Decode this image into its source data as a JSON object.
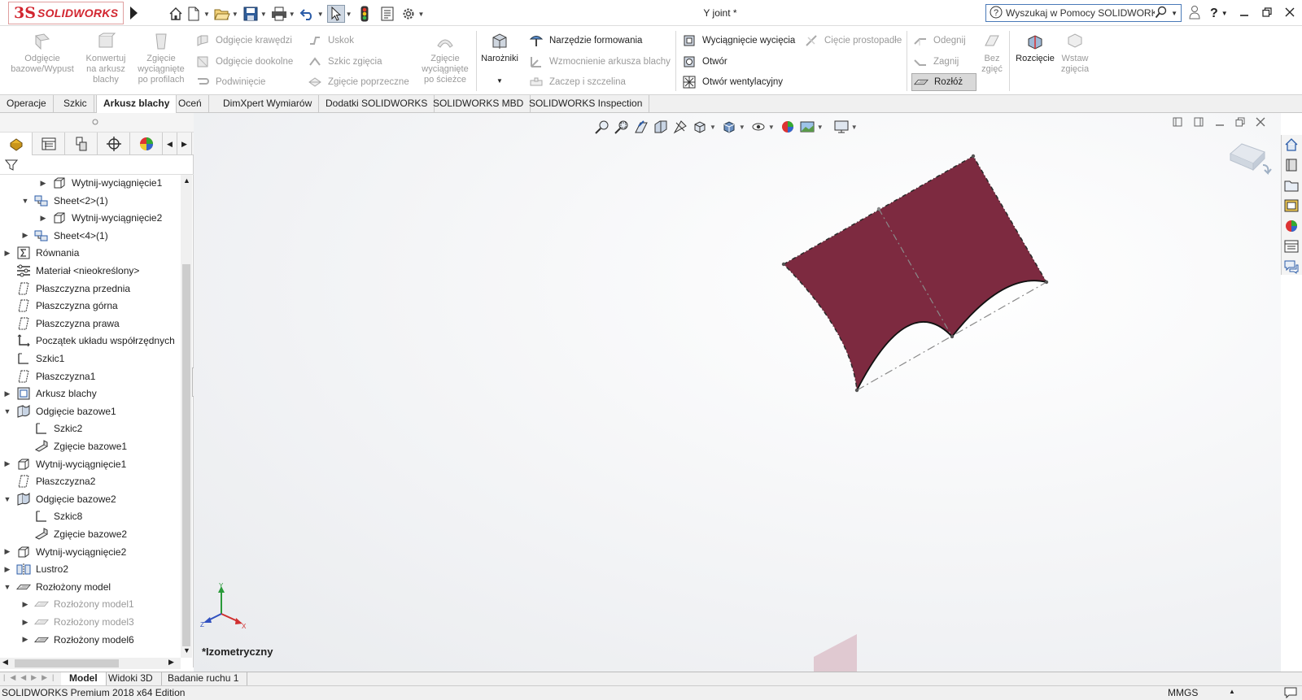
{
  "app": {
    "brand_ds": "3S",
    "brand_name": "SOLIDWORKS",
    "window_title": "Y joint *",
    "search_placeholder": "Wyszukaj w Pomocy SOLIDWORKS"
  },
  "ribbon": {
    "big_buttons": [
      {
        "label": "Odgięcie bazowe/Wypust",
        "enabled": false
      },
      {
        "label": "Konwertuj na arkusz blachy",
        "enabled": false
      },
      {
        "label": "Zgięcie wyciągnięte po profilach",
        "enabled": false
      },
      {
        "label": "Zgięcie wyciągnięte po ścieżce",
        "enabled": false
      },
      {
        "label": "Narożniki",
        "enabled": true
      },
      {
        "label": "Bez zgięć",
        "enabled": false
      },
      {
        "label": "Rozcięcie",
        "enabled": true
      },
      {
        "label": "Wstaw zgięcia",
        "enabled": false
      }
    ],
    "col1": [
      "Odgięcie krawędzi",
      "Odgięcie dookolne",
      "Podwinięcie"
    ],
    "col2": [
      "Uskok",
      "Szkic zgięcia",
      "Zgięcie poprzeczne"
    ],
    "col3": [
      "Narzędzie formowania",
      "Wzmocnienie arkusza blachy",
      "Zaczep i szczelina"
    ],
    "col4": [
      "Wyciągnięcie wycięcia",
      "Otwór",
      "Otwór wentylacyjny"
    ],
    "col5": [
      "Cięcie prostopadłe"
    ],
    "col6": [
      "Odegnij",
      "Zagnij",
      "Rozłóż"
    ]
  },
  "command_tabs": [
    {
      "label": "Operacje",
      "active": false
    },
    {
      "label": "Szkic",
      "active": false
    },
    {
      "label": "Arkusz blachy",
      "active": true
    },
    {
      "label": "Oceń",
      "active": false
    },
    {
      "label": "DimXpert Wymiarów",
      "active": false
    },
    {
      "label": "Dodatki SOLIDWORKS",
      "active": false
    },
    {
      "label": "SOLIDWORKS MBD",
      "active": false
    },
    {
      "label": "SOLIDWORKS Inspection",
      "active": false
    }
  ],
  "tree": [
    {
      "label": "Wytnij-wyciągnięcie1",
      "level": 2,
      "toggle": "collapsed",
      "icon": "cut-extrude-icon",
      "gray": false
    },
    {
      "label": "Sheet<2>(1)",
      "level": 1,
      "toggle": "expanded",
      "icon": "sheet-icon",
      "gray": false
    },
    {
      "label": "Wytnij-wyciągnięcie2",
      "level": 2,
      "toggle": "collapsed",
      "icon": "cut-extrude-icon",
      "gray": false
    },
    {
      "label": "Sheet<4>(1)",
      "level": 1,
      "toggle": "collapsed",
      "icon": "sheet-icon",
      "gray": false
    },
    {
      "label": "Równania",
      "level": 0,
      "toggle": "collapsed",
      "icon": "equations-icon",
      "gray": false
    },
    {
      "label": "Materiał <nieokreślony>",
      "level": 0,
      "toggle": "none",
      "icon": "material-icon",
      "gray": false
    },
    {
      "label": "Płaszczyzna przednia",
      "level": 0,
      "toggle": "none",
      "icon": "plane-icon",
      "gray": false
    },
    {
      "label": "Płaszczyzna górna",
      "level": 0,
      "toggle": "none",
      "icon": "plane-icon",
      "gray": false
    },
    {
      "label": "Płaszczyzna prawa",
      "level": 0,
      "toggle": "none",
      "icon": "plane-icon",
      "gray": false
    },
    {
      "label": "Początek układu współrzędnych",
      "level": 0,
      "toggle": "none",
      "icon": "origin-icon",
      "gray": false
    },
    {
      "label": "Szkic1",
      "level": 0,
      "toggle": "none",
      "icon": "sketch-icon",
      "gray": false
    },
    {
      "label": "Płaszczyzna1",
      "level": 0,
      "toggle": "none",
      "icon": "plane-icon",
      "gray": false
    },
    {
      "label": "Arkusz blachy",
      "level": 0,
      "toggle": "collapsed",
      "icon": "sheet-metal-icon",
      "gray": false
    },
    {
      "label": "Odgięcie bazowe1",
      "level": 0,
      "toggle": "expanded",
      "icon": "base-flange-icon",
      "gray": false
    },
    {
      "label": "Szkic2",
      "level": 1,
      "toggle": "none",
      "icon": "sketch-icon",
      "gray": false
    },
    {
      "label": "Zgięcie bazowe1",
      "level": 1,
      "toggle": "none",
      "icon": "bend-icon",
      "gray": false
    },
    {
      "label": "Wytnij-wyciągnięcie1",
      "level": 0,
      "toggle": "collapsed",
      "icon": "cut-extrude-icon",
      "gray": false
    },
    {
      "label": "Płaszczyzna2",
      "level": 0,
      "toggle": "none",
      "icon": "plane-icon",
      "gray": false
    },
    {
      "label": "Odgięcie bazowe2",
      "level": 0,
      "toggle": "expanded",
      "icon": "base-flange-icon",
      "gray": false
    },
    {
      "label": "Szkic8",
      "level": 1,
      "toggle": "none",
      "icon": "sketch-icon",
      "gray": false
    },
    {
      "label": "Zgięcie bazowe2",
      "level": 1,
      "toggle": "none",
      "icon": "bend-icon",
      "gray": false
    },
    {
      "label": "Wytnij-wyciągnięcie2",
      "level": 0,
      "toggle": "collapsed",
      "icon": "cut-extrude-icon",
      "gray": false
    },
    {
      "label": "Lustro2",
      "level": 0,
      "toggle": "collapsed",
      "icon": "mirror-icon",
      "gray": false
    },
    {
      "label": "Rozłożony model",
      "level": 0,
      "toggle": "expanded",
      "icon": "flat-pattern-icon",
      "gray": false
    },
    {
      "label": "Rozłożony model1",
      "level": 1,
      "toggle": "collapsed",
      "icon": "flat-pattern-icon",
      "gray": true
    },
    {
      "label": "Rozłożony model3",
      "level": 1,
      "toggle": "collapsed",
      "icon": "flat-pattern-icon",
      "gray": true
    },
    {
      "label": "Rozłożony model6",
      "level": 1,
      "toggle": "collapsed",
      "icon": "flat-pattern-icon",
      "gray": false
    }
  ],
  "viewport": {
    "view_label": "*Izometryczny",
    "part_color": "#7d2a40",
    "triad": {
      "x": "X",
      "y": "Y",
      "z": "Z"
    }
  },
  "bottom_tabs": [
    {
      "label": "Model",
      "active": true
    },
    {
      "label": "Widoki 3D",
      "active": false
    },
    {
      "label": "Badanie ruchu 1",
      "active": false
    }
  ],
  "status": {
    "edition": "SOLIDWORKS Premium 2018 x64 Edition",
    "units": "MMGS"
  }
}
